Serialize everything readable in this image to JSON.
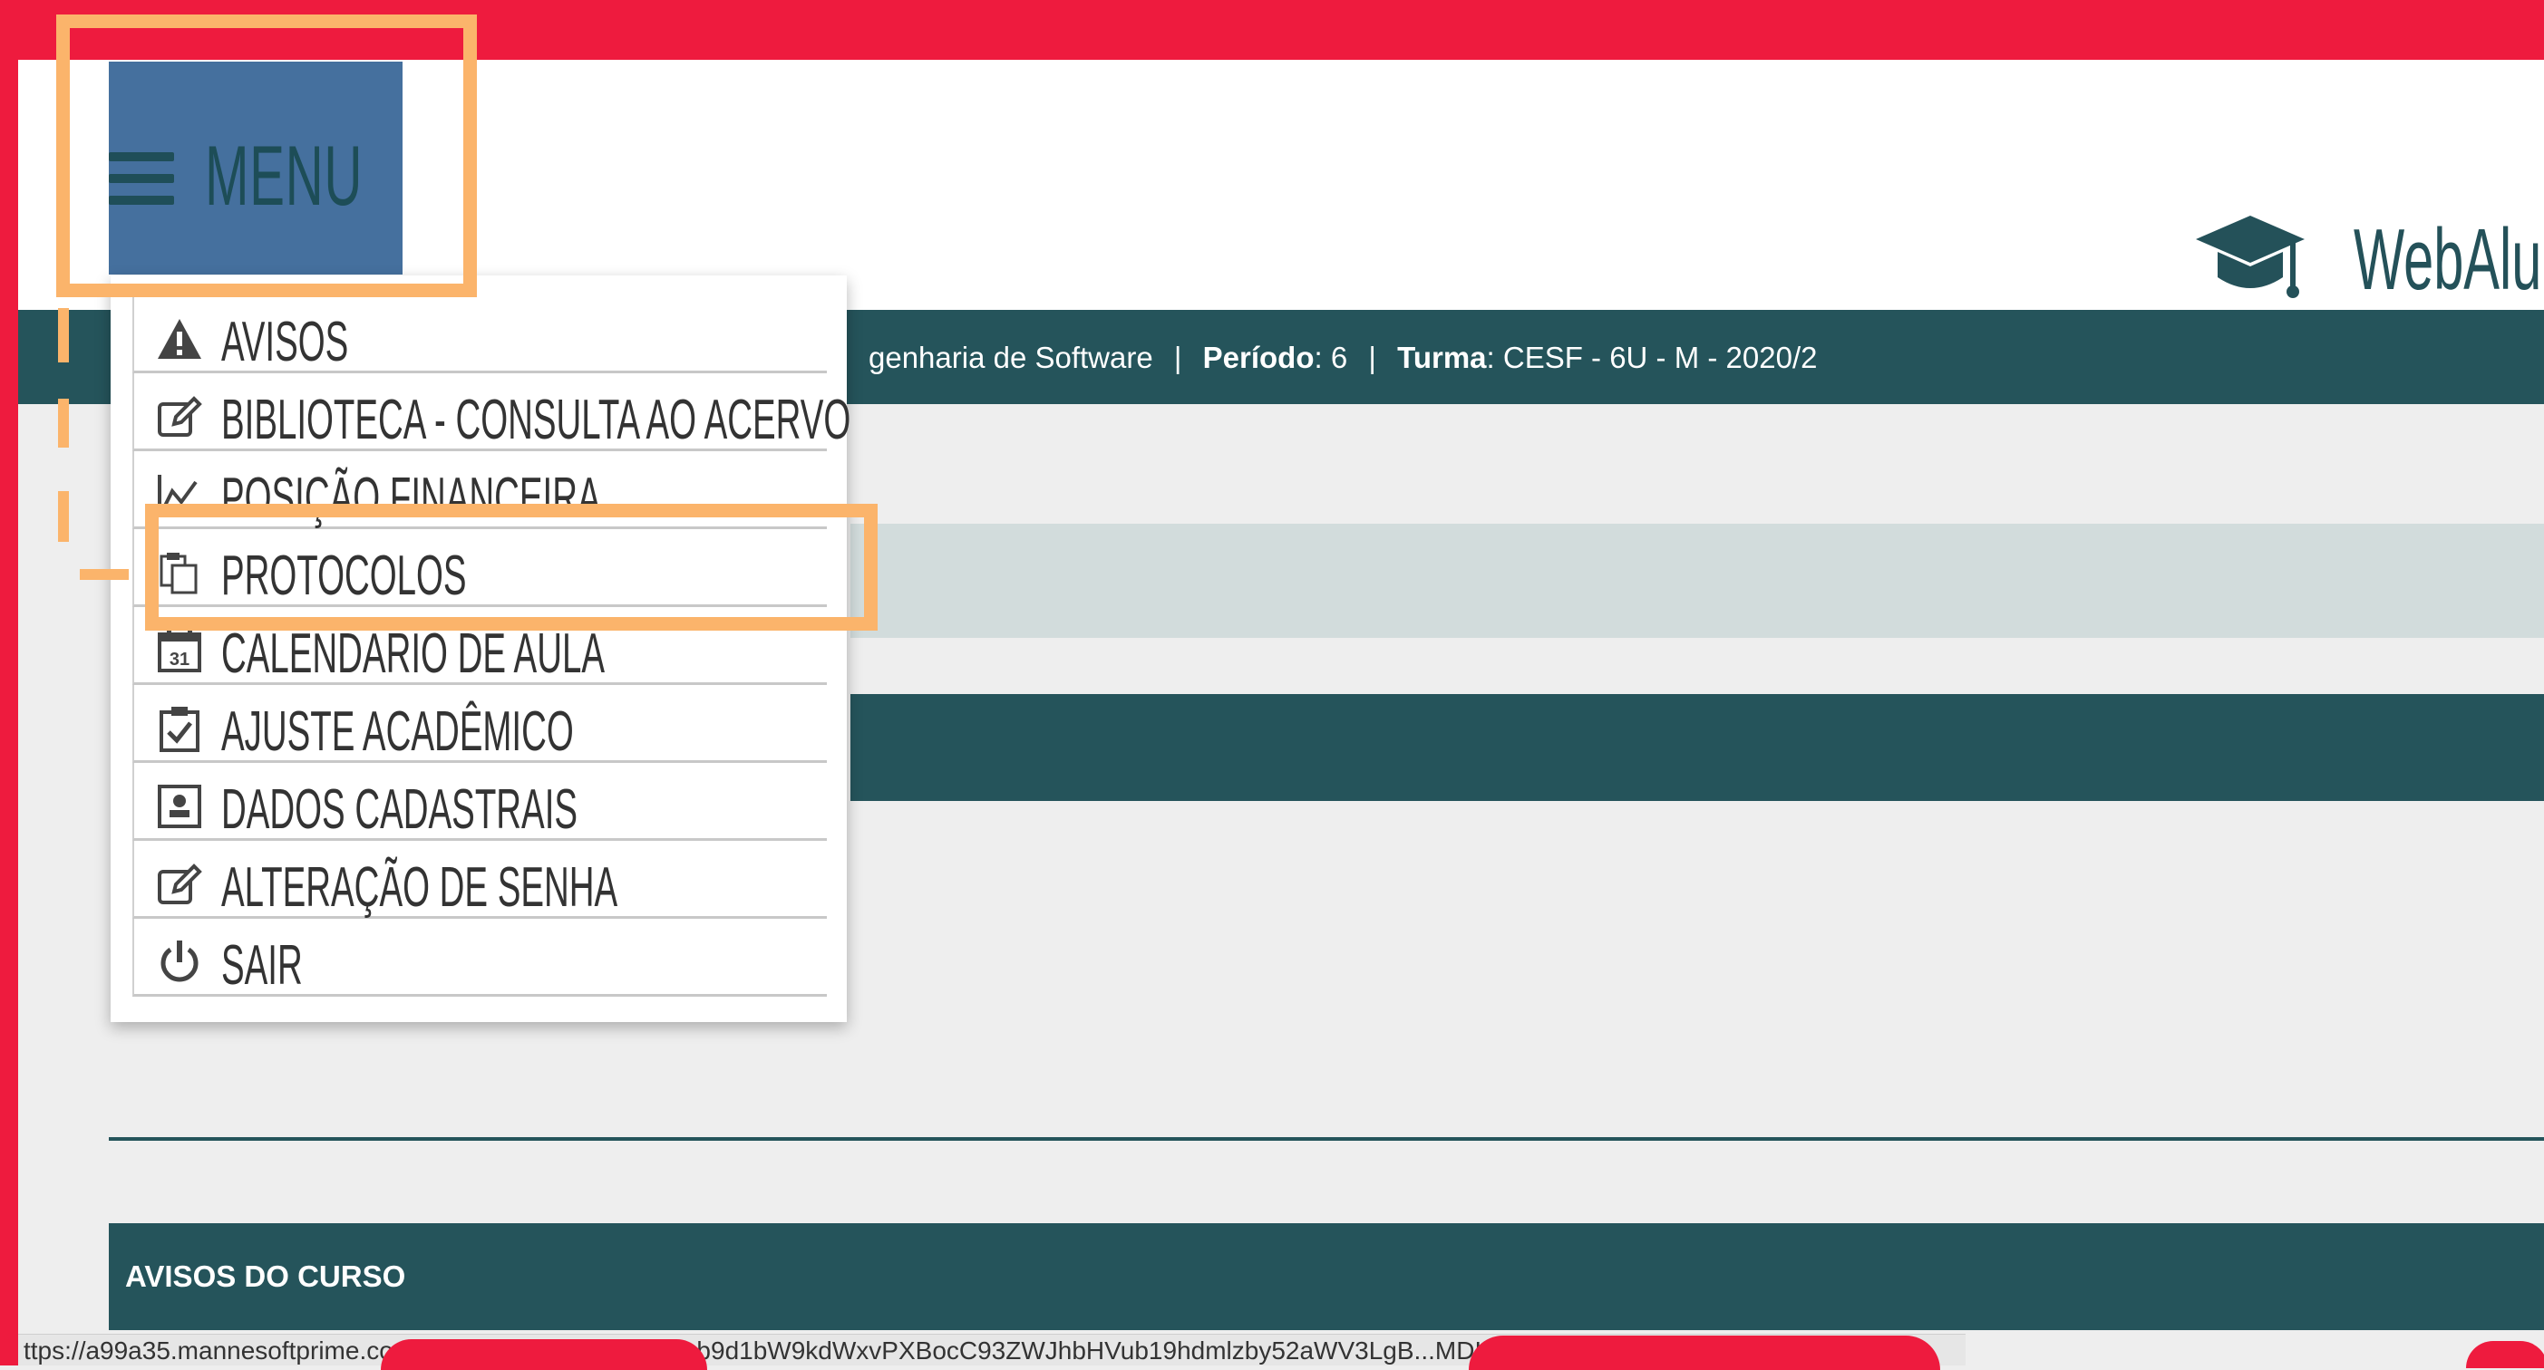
{
  "header": {
    "menu_label": "MENU",
    "brand_text": "WebAlu"
  },
  "infobar": {
    "course_partial": "genharia de Software",
    "periodo_label": "Período",
    "periodo_value": ": 6",
    "turma_label": "Turma",
    "turma_value": ": CESF - 6U - M - 2020/2"
  },
  "menu": {
    "items": [
      {
        "label": "AVISOS",
        "icon": "warning-icon"
      },
      {
        "label": "BIBLIOTECA - CONSULTA AO ACERVO",
        "icon": "edit-icon"
      },
      {
        "label": "POSIÇÃO FINANCEIRA",
        "icon": "line-chart-icon"
      },
      {
        "label": "PROTOCOLOS",
        "icon": "clipboard-copy-icon"
      },
      {
        "label": "CALENDÁRIO DE AULA",
        "icon": "calendar-icon"
      },
      {
        "label": "AJUSTE ACADÊMICO",
        "icon": "clipboard-check-icon"
      },
      {
        "label": "DADOS CADASTRAIS",
        "icon": "id-card-icon"
      },
      {
        "label": "ALTERAÇÃO DE SENHA",
        "icon": "edit-icon"
      },
      {
        "label": "SAIR",
        "icon": "power-icon"
      }
    ]
  },
  "avisos_section": {
    "title": "AVISOS DO CURSO"
  },
  "status": {
    "url": "ttps://a99a35.mannesoftprime.com.b/...o_simul/index.php?ob9d1bW9kdWxvPXBocC93ZWJhbHVub19hdmlzby52aWV3LgB...MDIw9d68f#"
  },
  "colors": {
    "annotation_red": "#ee1b3e",
    "annotation_orange": "#fbb46b",
    "menu_button_blue": "#45709e",
    "teal_dark": "#25545b"
  }
}
